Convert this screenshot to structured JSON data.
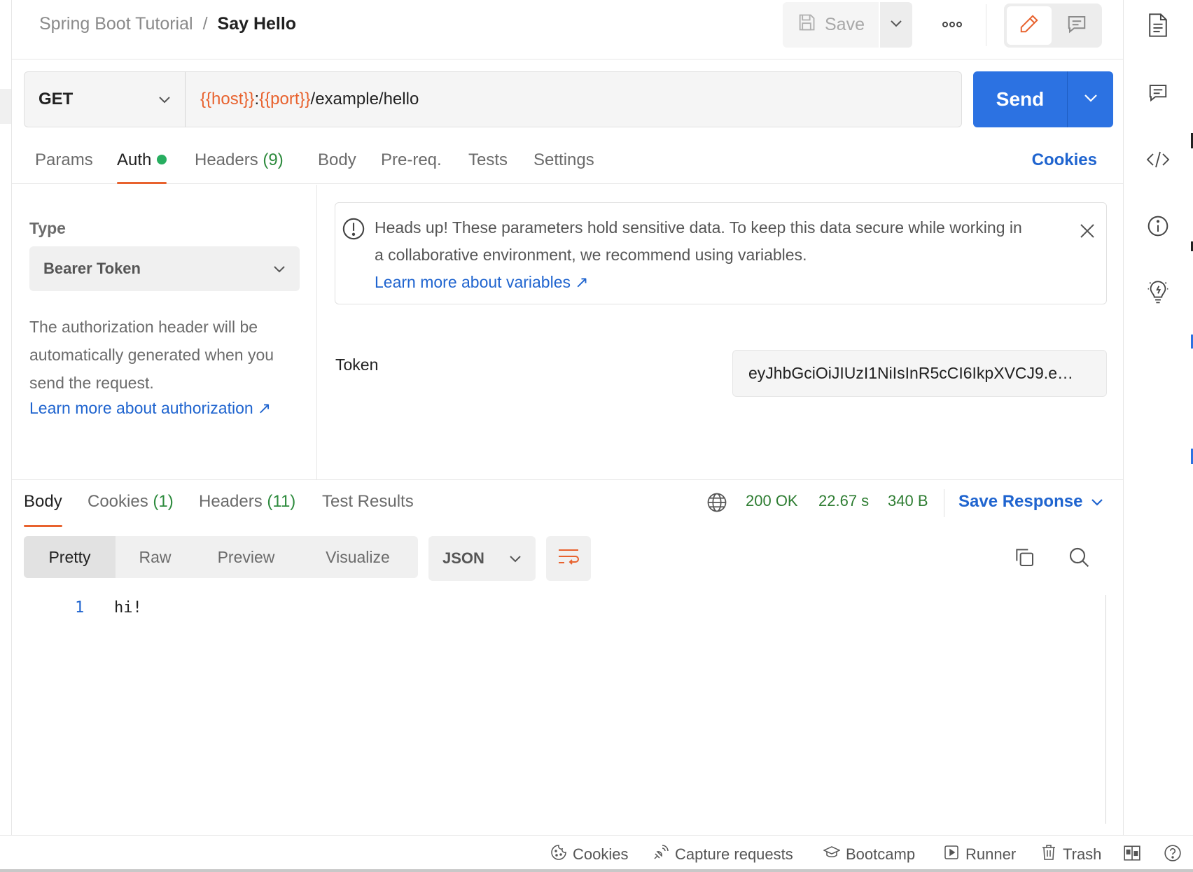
{
  "breadcrumb": {
    "parent": "Spring Boot Tutorial",
    "separator": "/",
    "current": "Say Hello"
  },
  "toolbar": {
    "save_label": "Save"
  },
  "request": {
    "method": "GET",
    "url_parts": {
      "host": "{{host}}",
      "colon": ":",
      "port": "{{port}}",
      "path": "/example/hello"
    },
    "send_label": "Send"
  },
  "request_tabs": {
    "params": "Params",
    "auth": "Auth",
    "headers": "Headers",
    "headers_count": "(9)",
    "body": "Body",
    "prereq": "Pre-req.",
    "tests": "Tests",
    "settings": "Settings",
    "cookies": "Cookies"
  },
  "auth": {
    "type_label": "Type",
    "type_value": "Bearer Token",
    "description": "The authorization header will be automatically generated when you send the request.",
    "learn_link": "Learn more about authorization ↗",
    "notice_text": "Heads up! These parameters hold sensitive data. To keep this data secure while working in a collaborative environment, we recommend using variables.",
    "notice_link": "Learn more about variables ↗",
    "token_label": "Token",
    "token_value": "eyJhbGciOiJIUzI1NiIsInR5cCI6IkpXVCJ9.e…"
  },
  "response_tabs": {
    "body": "Body",
    "cookies": "Cookies",
    "cookies_count": "(1)",
    "headers": "Headers",
    "headers_count": "(11)",
    "test_results": "Test Results"
  },
  "response_meta": {
    "status": "200 OK",
    "time": "22.67 s",
    "size": "340 B",
    "save_response": "Save Response"
  },
  "view_modes": {
    "pretty": "Pretty",
    "raw": "Raw",
    "preview": "Preview",
    "visualize": "Visualize"
  },
  "format": "JSON",
  "response_body": {
    "line_number": "1",
    "line_text": "hi!"
  },
  "statusbar": {
    "cookies": "Cookies",
    "capture": "Capture requests",
    "bootcamp": "Bootcamp",
    "runner": "Runner",
    "trash": "Trash"
  },
  "colors": {
    "accent_blue": "#2c72e2",
    "link_blue": "#1f64cf",
    "variable_orange": "#e8622e",
    "success_green": "#2e7d32"
  },
  "icons": {
    "save": "floppy-disk-icon",
    "more": "ellipsis-icon",
    "edit": "pencil-icon",
    "comment": "comment-icon",
    "docs": "document-icon",
    "code": "code-icon",
    "info": "info-icon",
    "lightbulb": "lightbulb-icon",
    "globe": "globe-icon",
    "copy": "copy-icon",
    "search": "search-icon",
    "wrap": "wrap-lines-icon"
  }
}
